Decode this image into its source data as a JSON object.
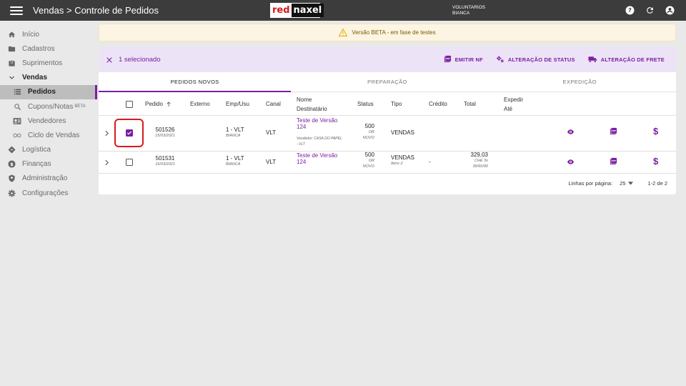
{
  "header": {
    "title": "Vendas > Controle de Pedidos",
    "logo_red": "red",
    "logo_dark": "naxel",
    "user_org": "VOLUNTARIOS",
    "user_name": "BIANCA"
  },
  "sidebar": {
    "items": [
      {
        "label": "Início",
        "icon": "home-icon"
      },
      {
        "label": "Cadastros",
        "icon": "folder-icon"
      },
      {
        "label": "Suprimentos",
        "icon": "box-icon"
      },
      {
        "label": "Vendas",
        "icon": "chevron-down-icon"
      },
      {
        "label": "Pedidos",
        "icon": "list-icon"
      },
      {
        "label": "Cupons/Notas",
        "badge": "BETA",
        "icon": "receipt-search-icon"
      },
      {
        "label": "Vendedores",
        "icon": "id-card-icon"
      },
      {
        "label": "Ciclo de Vendas",
        "icon": "infinity-icon"
      },
      {
        "label": "Logística",
        "icon": "diamond-icon"
      },
      {
        "label": "Finanças",
        "icon": "dollar-circle-icon"
      },
      {
        "label": "Administração",
        "icon": "shield-icon"
      },
      {
        "label": "Configurações",
        "icon": "gear-icon"
      }
    ]
  },
  "banner": {
    "text": "Versão BETA - em fase de testes"
  },
  "selection": {
    "text": "1 selecionado",
    "actions": [
      "EMITIR NF",
      "ALTERAÇÃO DE STATUS",
      "ALTERAÇÃO DE FRETE"
    ]
  },
  "tabs": [
    "PEDIDOS NOVOS",
    "PREPARAÇÃO",
    "EXPEDIÇÃO"
  ],
  "columns": {
    "pedido": "Pedido",
    "externo": "Externo",
    "emp": "Emp/Usu",
    "canal": "Canal",
    "nome": "Nome",
    "destinatario": "Destinatário",
    "status": "Status",
    "tipo": "Tipo",
    "credito": "Crédito",
    "total": "Total",
    "expedir": "Expedir",
    "ate": "Até"
  },
  "rows": [
    {
      "pedido": "501526",
      "data": "15/03/2021",
      "emp": "1 - VLT",
      "usu": "BIANCA",
      "canal": "VLT",
      "nome": "Teste de Versão 124",
      "vendedor": "Vendedor: CASA DO PAPEL - VLT",
      "status": "500",
      "status_sub1": "OR",
      "status_sub2": "NOVO",
      "tipo": "VENDAS",
      "tipo_sub": "",
      "credito": "",
      "total": "",
      "total_sub1": "",
      "total_sub2": "",
      "checked": true
    },
    {
      "pedido": "501531",
      "data": "16/03/2021",
      "emp": "1 - VLT",
      "usu": "BIANCA",
      "canal": "VLT",
      "nome": "Teste de Versão 124",
      "vendedor": "",
      "status": "500",
      "status_sub1": "OR",
      "status_sub2": "NOVO",
      "tipo": "VENDAS",
      "tipo_sub": "Itens 2",
      "credito": "-",
      "total": "329,03",
      "total_sub1": "CHE 3x",
      "total_sub2": "30/60/90",
      "checked": false
    }
  ],
  "footer": {
    "rows_label": "Linhas por página:",
    "rows_value": "25",
    "range": "1-2 de 2"
  },
  "colors": {
    "accent": "#7b1fa2",
    "topbar": "#3c3c3c",
    "highlight": "#d81b1b"
  }
}
